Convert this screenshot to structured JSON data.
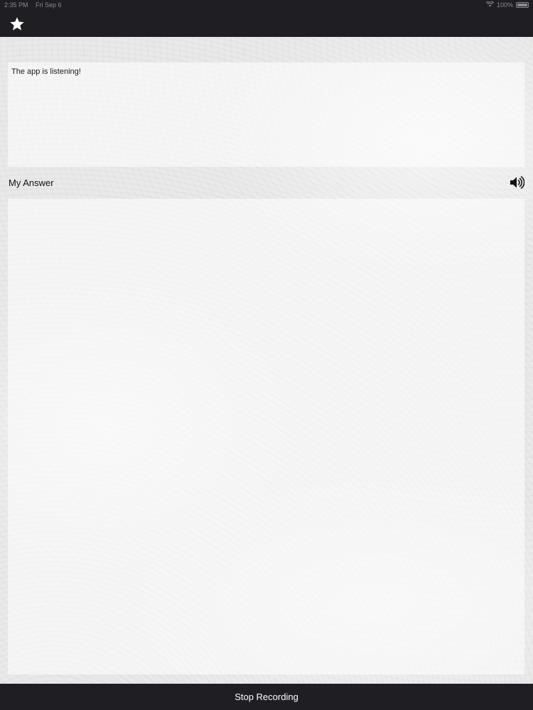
{
  "status_bar": {
    "time": "2:35 PM",
    "date": "Fri Sep 6",
    "battery_percent": "100%",
    "icons": [
      "wifi-icon",
      "battery-icon"
    ]
  },
  "nav_bar": {
    "icons": [
      "star-icon"
    ]
  },
  "prompt": {
    "text": "The app is listening!"
  },
  "answer": {
    "label": "My Answer",
    "value": "",
    "icons": [
      "speaker-icon"
    ]
  },
  "bottom_bar": {
    "action_label": "Stop Recording"
  },
  "colors": {
    "bar_background": "#1f1e22",
    "bar_text": "#ffffff",
    "status_text": "#8c8c90",
    "panel_background": "#ffffff",
    "page_background": "#e9e9ea"
  }
}
